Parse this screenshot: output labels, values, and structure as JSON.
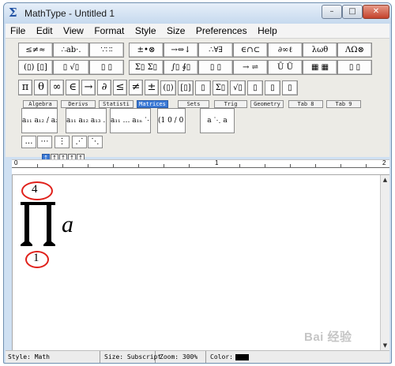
{
  "window": {
    "app_icon": "Σ",
    "title": "MathType - Untitled 1",
    "minimize": "–",
    "maximize": "□",
    "close": "✕"
  },
  "menu": [
    "File",
    "Edit",
    "View",
    "Format",
    "Style",
    "Size",
    "Preferences",
    "Help"
  ],
  "toolbar_row1": [
    "≤≠≈",
    "∴ab·.",
    "∵∷∶",
    "±•⊗",
    "→⇔↓",
    "∴∀∃",
    "∈∩⊂",
    "∂∞ℓ",
    "λωθ",
    "ΛΩ⊗"
  ],
  "toolbar_row2": [
    "(▯) [▯]",
    "▯ √▯",
    "▯ ▯",
    "Σ▯ Σ▯",
    "∫▯ ∮▯",
    "▯ ▯",
    "→ ⇌",
    "Ū Ũ",
    "▦ ▦",
    "▯ ▯"
  ],
  "toolbar_row3": [
    "π",
    "θ",
    "∞",
    "∈",
    "→",
    "∂",
    "≤",
    "≠",
    "±",
    "(▯)",
    "[▯]",
    "▯",
    "Σ▯",
    "√▯",
    "▯",
    "▯",
    "▯"
  ],
  "tabs": [
    "Algebra",
    "Derivs",
    "Statisti",
    "Matrices",
    "Sets",
    "Trig",
    "Geometry",
    "Tab 8",
    "Tab 9"
  ],
  "active_tab": "Matrices",
  "templates": [
    "a₁₁ a₁₂ / a₂₁ a₂₂",
    "a₁₁ a₁₂ a₁₃ …",
    "a₁₁ … a₁ₙ ⋱",
    "(1 0 / 0 1)",
    "a ⋱ a"
  ],
  "dots_row": [
    "…",
    "⋯",
    "⋮",
    "⋰",
    "⋱"
  ],
  "tabstop_icons": [
    "↑",
    "↑",
    "↑",
    "↑",
    "↑"
  ],
  "ruler": {
    "marks": [
      "0",
      "1",
      "2"
    ]
  },
  "equation": {
    "upper_limit": "4",
    "lower_limit": "1",
    "operator": "∏",
    "variable": "a"
  },
  "annotation_color": "#e0201a",
  "status": {
    "style": "Style: Math",
    "size": "Size: Subscript",
    "zoom": "Zoom: 300%",
    "color": "Color:",
    "color_value": "#000000"
  },
  "watermark": "Bai 经验"
}
